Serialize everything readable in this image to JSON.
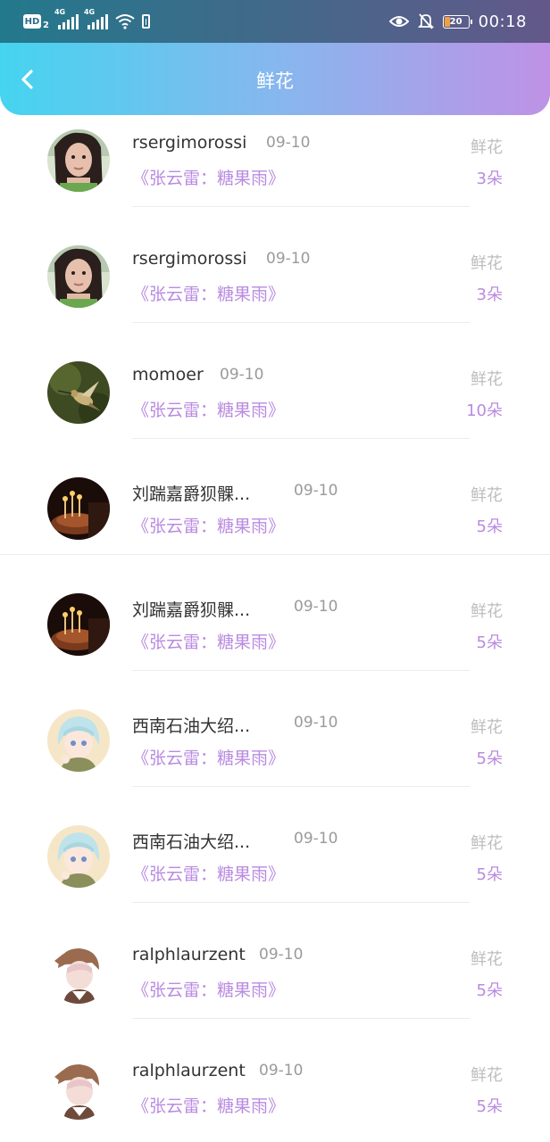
{
  "status_bar": {
    "hd_label": "HD",
    "hd_sub": "2",
    "net1": "4G",
    "net2": "4G",
    "battery_level": "20",
    "time": "00:18",
    "icons": [
      "hd-icon",
      "signal-icon",
      "signal-icon",
      "wifi-icon",
      "battery-saver-icon",
      "eye-icon",
      "bell-off-icon",
      "battery-icon"
    ]
  },
  "header": {
    "title": "鲜花",
    "back_icon": "chevron-left-icon"
  },
  "colors": {
    "header_start": "#45d4ef",
    "header_end": "#bf92e6",
    "accent_purple": "#b98be0",
    "gray_text": "#9a9a9a"
  },
  "records": [
    {
      "user": "rsergimorossi",
      "date": "09-10",
      "work": "《张云雷：糖果雨》",
      "gift_label": "鲜花",
      "count": "3朵",
      "avatar": "woman-photo"
    },
    {
      "user": "rsergimorossi",
      "date": "09-10",
      "work": "《张云雷：糖果雨》",
      "gift_label": "鲜花",
      "count": "3朵",
      "avatar": "woman-photo"
    },
    {
      "user": "momoer",
      "date": "09-10",
      "work": "《张云雷：糖果雨》",
      "gift_label": "鲜花",
      "count": "10朵",
      "avatar": "hummingbird-photo"
    },
    {
      "user": "刘踹嘉爵狈髁...",
      "date": "09-10",
      "work": "《张云雷：糖果雨》",
      "gift_label": "鲜花",
      "count": "5朵",
      "avatar": "candles-photo"
    },
    {
      "user": "刘踹嘉爵狈髁...",
      "date": "09-10",
      "work": "《张云雷：糖果雨》",
      "gift_label": "鲜花",
      "count": "5朵",
      "avatar": "candles-photo"
    },
    {
      "user": "西南石油大绍...",
      "date": "09-10",
      "work": "《张云雷：糖果雨》",
      "gift_label": "鲜花",
      "count": "5朵",
      "avatar": "anime-girl"
    },
    {
      "user": "西南石油大绍...",
      "date": "09-10",
      "work": "《张云雷：糖果雨》",
      "gift_label": "鲜花",
      "count": "5朵",
      "avatar": "anime-girl"
    },
    {
      "user": "ralphlaurzent",
      "date": "09-10",
      "work": "《张云雷：糖果雨》",
      "gift_label": "鲜花",
      "count": "5朵",
      "avatar": "anime-boy"
    },
    {
      "user": "ralphlaurzent",
      "date": "09-10",
      "work": "《张云雷：糖果雨》",
      "gift_label": "鲜花",
      "count": "5朵",
      "avatar": "anime-boy"
    }
  ]
}
